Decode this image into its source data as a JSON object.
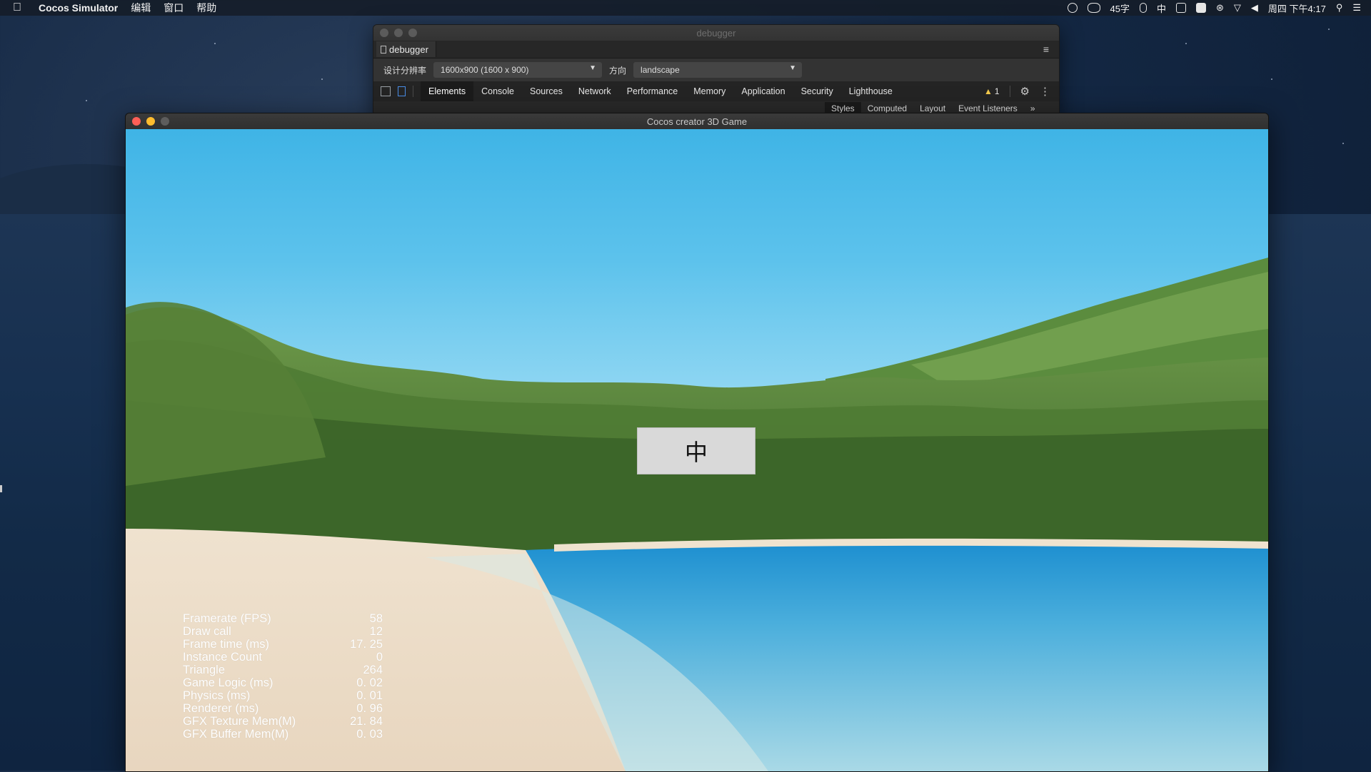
{
  "menubar": {
    "apple": "",
    "app_name": "Cocos Simulator",
    "items": [
      "编辑",
      "窗口",
      "帮助"
    ],
    "status": {
      "temp": "45字",
      "ime": "中",
      "datetime": "周四 下午4:17"
    }
  },
  "debugger": {
    "title": "debugger",
    "tab_label": "debugger",
    "resolution_label": "设计分辨率",
    "resolution_value": "1600x900 (1600 x 900)",
    "orientation_label": "方向",
    "orientation_value": "landscape",
    "devtools_tabs": [
      "Elements",
      "Console",
      "Sources",
      "Network",
      "Performance",
      "Memory",
      "Application",
      "Security",
      "Lighthouse"
    ],
    "active_tab": "Elements",
    "warning_count": "1",
    "styles_tabs": [
      "Styles",
      "Computed",
      "Layout",
      "Event Listeners"
    ],
    "more": "»"
  },
  "game": {
    "title": "Cocos creator 3D Game",
    "button_label": "中",
    "stats": [
      {
        "label": "Framerate (FPS)",
        "value": "58"
      },
      {
        "label": "Draw call",
        "value": "12"
      },
      {
        "label": "Frame time (ms)",
        "value": "17. 25"
      },
      {
        "label": "Instance Count",
        "value": "0"
      },
      {
        "label": "Triangle",
        "value": "264"
      },
      {
        "label": "Game Logic (ms)",
        "value": "0. 02"
      },
      {
        "label": "Physics (ms)",
        "value": "0. 01"
      },
      {
        "label": "Renderer (ms)",
        "value": "0. 96"
      },
      {
        "label": "GFX Texture Mem(M)",
        "value": "21. 84"
      },
      {
        "label": "GFX Buffer Mem(M)",
        "value": "0. 03"
      }
    ]
  }
}
